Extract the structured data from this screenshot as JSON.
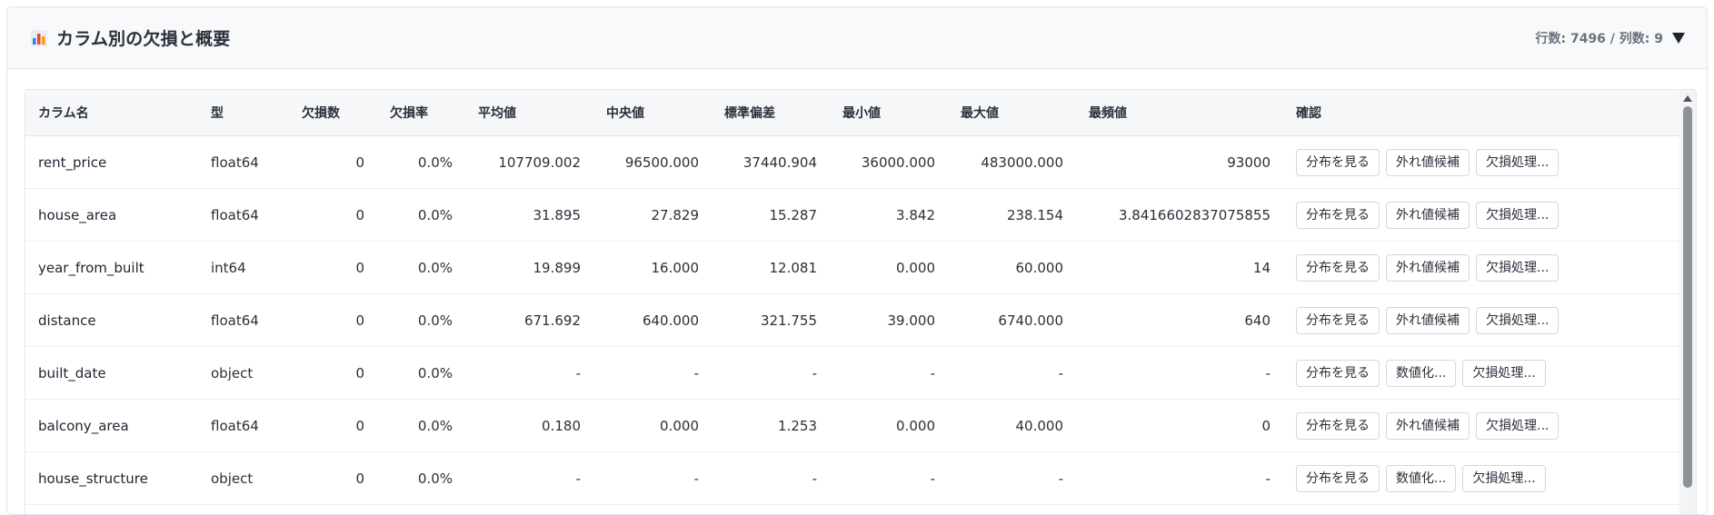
{
  "panel": {
    "title": "カラム別の欠損と概要",
    "meta": "行数: 7496 / 列数: 9",
    "icon": "bar-chart-icon",
    "collapse_icon": "triangle-down-icon"
  },
  "table": {
    "headers": [
      "カラム名",
      "型",
      "欠損数",
      "欠損率",
      "平均値",
      "中央値",
      "標準偏差",
      "最小値",
      "最大値",
      "最頻値",
      "確認"
    ],
    "rows": [
      {
        "name": "rent_price",
        "type": "float64",
        "missing": "0",
        "rate": "0.0%",
        "mean": "107709.002",
        "median": "96500.000",
        "std": "37440.904",
        "min": "36000.000",
        "max": "483000.000",
        "mode": "93000",
        "actions": [
          "分布を見る",
          "外れ値候補",
          "欠損処理..."
        ]
      },
      {
        "name": "house_area",
        "type": "float64",
        "missing": "0",
        "rate": "0.0%",
        "mean": "31.895",
        "median": "27.829",
        "std": "15.287",
        "min": "3.842",
        "max": "238.154",
        "mode": "3.8416602837075855",
        "actions": [
          "分布を見る",
          "外れ値候補",
          "欠損処理..."
        ]
      },
      {
        "name": "year_from_built",
        "type": "int64",
        "missing": "0",
        "rate": "0.0%",
        "mean": "19.899",
        "median": "16.000",
        "std": "12.081",
        "min": "0.000",
        "max": "60.000",
        "mode": "14",
        "actions": [
          "分布を見る",
          "外れ値候補",
          "欠損処理..."
        ]
      },
      {
        "name": "distance",
        "type": "float64",
        "missing": "0",
        "rate": "0.0%",
        "mean": "671.692",
        "median": "640.000",
        "std": "321.755",
        "min": "39.000",
        "max": "6740.000",
        "mode": "640",
        "actions": [
          "分布を見る",
          "外れ値候補",
          "欠損処理..."
        ]
      },
      {
        "name": "built_date",
        "type": "object",
        "missing": "0",
        "rate": "0.0%",
        "mean": "-",
        "median": "-",
        "std": "-",
        "min": "-",
        "max": "-",
        "mode": "-",
        "actions": [
          "分布を見る",
          "数値化...",
          "欠損処理..."
        ]
      },
      {
        "name": "balcony_area",
        "type": "float64",
        "missing": "0",
        "rate": "0.0%",
        "mean": "0.180",
        "median": "0.000",
        "std": "1.253",
        "min": "0.000",
        "max": "40.000",
        "mode": "0",
        "actions": [
          "分布を見る",
          "外れ値候補",
          "欠損処理..."
        ]
      },
      {
        "name": "house_structure",
        "type": "object",
        "missing": "0",
        "rate": "0.0%",
        "mean": "-",
        "median": "-",
        "std": "-",
        "min": "-",
        "max": "-",
        "mode": "-",
        "actions": [
          "分布を見る",
          "数値化...",
          "欠損処理..."
        ]
      }
    ]
  },
  "colors": {
    "header_bg": "#f8f9fb",
    "border": "#e2e5ea",
    "thumb": "#8d9198"
  }
}
